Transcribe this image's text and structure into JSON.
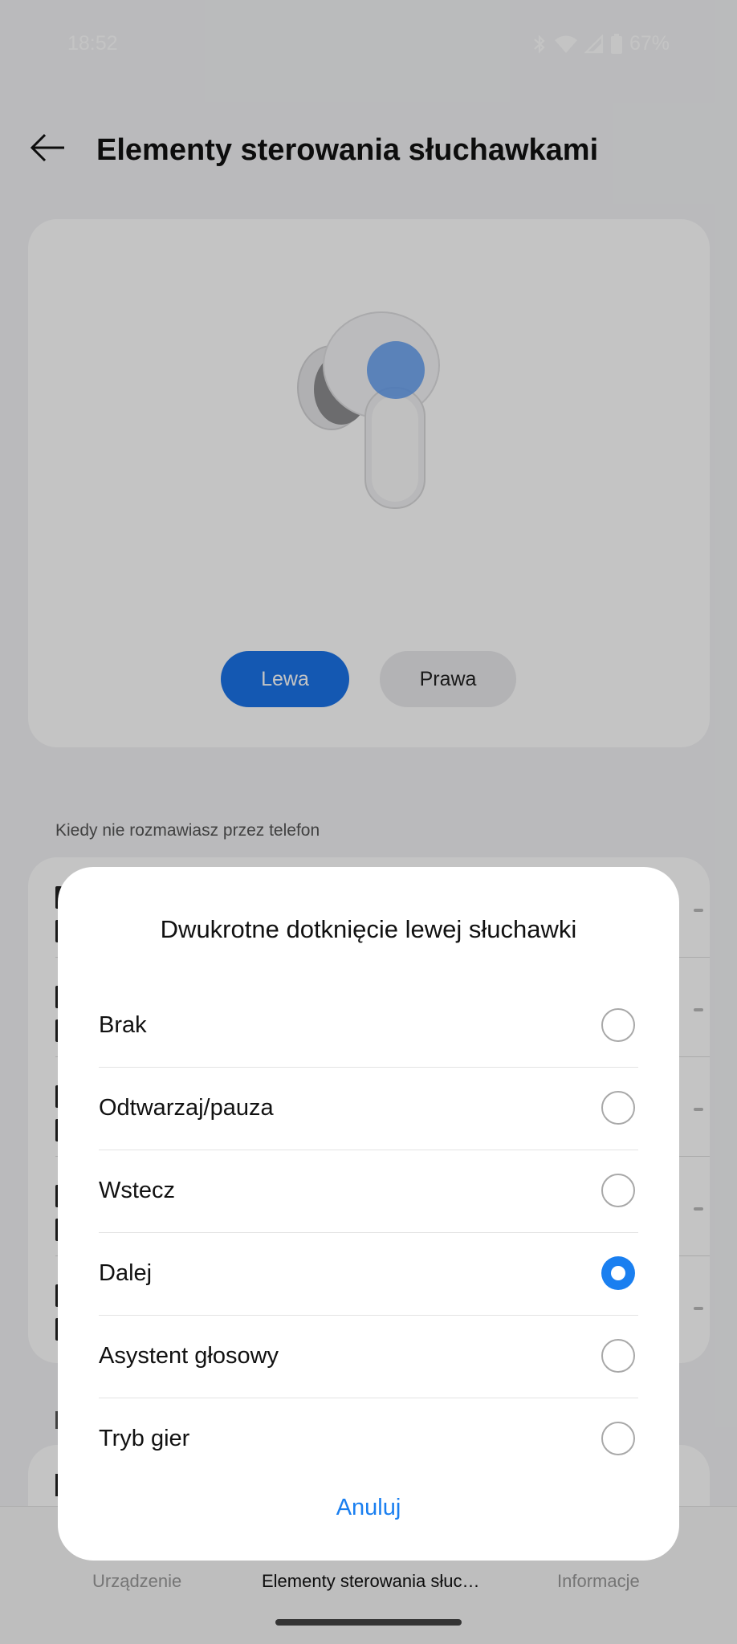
{
  "status_bar": {
    "time": "18:52",
    "battery": "67%",
    "icons": [
      "bluetooth-icon",
      "wifi-icon",
      "signal-icon",
      "battery-icon"
    ]
  },
  "header": {
    "title": "Elementy sterowania słuchawkami",
    "back_icon": "back-arrow-icon"
  },
  "earbud_selector": {
    "options": [
      "Lewa",
      "Prawa"
    ],
    "selected": "Lewa"
  },
  "section_label": "Kiedy nie rozmawiasz przez telefon",
  "dialog": {
    "title": "Dwukrotne dotknięcie lewej słuchawki",
    "options": [
      {
        "label": "Brak",
        "checked": false
      },
      {
        "label": "Odtwarzaj/pauza",
        "checked": false
      },
      {
        "label": "Wstecz",
        "checked": false
      },
      {
        "label": "Dalej",
        "checked": true
      },
      {
        "label": "Asystent głosowy",
        "checked": false
      },
      {
        "label": "Tryb gier",
        "checked": false
      }
    ],
    "cancel_label": "Anuluj"
  },
  "bottom_nav": {
    "tabs": [
      "Urządzenie",
      "Elementy sterowania słuc…",
      "Informacje"
    ],
    "active": "Elementy sterowania słuc…"
  },
  "colors": {
    "accent": "#1a7ff0",
    "segment_active": "#1a73e8",
    "background": "#f2f3f5"
  }
}
